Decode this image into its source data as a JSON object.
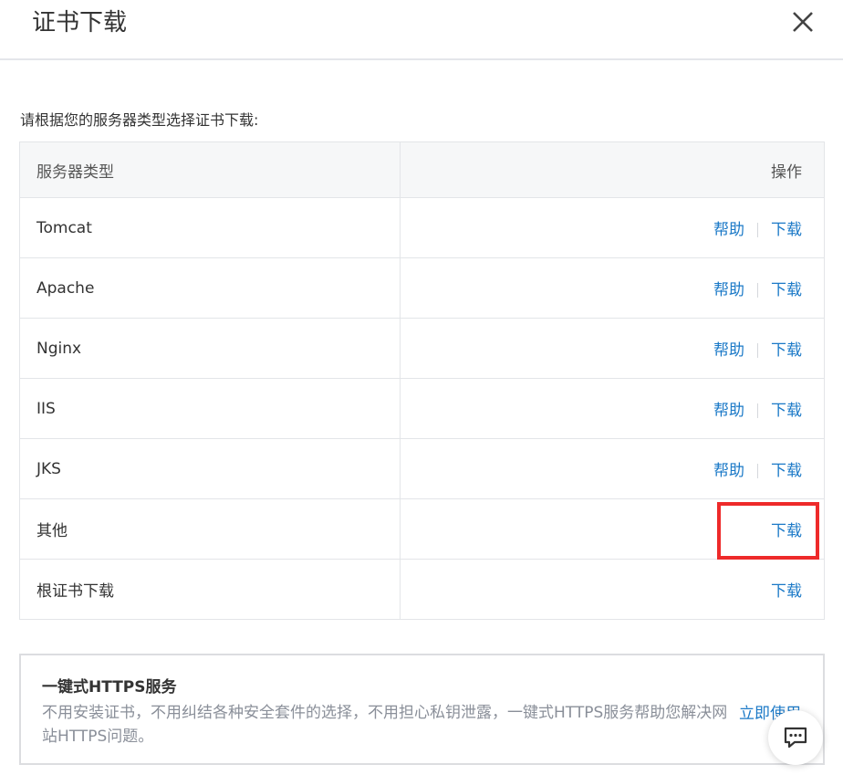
{
  "dialog": {
    "title": "证书下载",
    "close_icon": "close-icon"
  },
  "instruction": "请根据您的服务器类型选择证书下载:",
  "table": {
    "headers": [
      "服务器类型",
      "操作"
    ],
    "rows": [
      {
        "server": "Tomcat",
        "help": "帮助",
        "download": "下载"
      },
      {
        "server": "Apache",
        "help": "帮助",
        "download": "下载"
      },
      {
        "server": "Nginx",
        "help": "帮助",
        "download": "下载"
      },
      {
        "server": "IIS",
        "help": "帮助",
        "download": "下载"
      },
      {
        "server": "JKS",
        "help": "帮助",
        "download": "下载"
      },
      {
        "server": "其他",
        "download": "下载"
      },
      {
        "server": "根证书下载",
        "download": "下载"
      }
    ]
  },
  "promo": {
    "title": "一键式HTTPS服务",
    "description": "不用安装证书，不用纠结各种安全套件的选择，不用担心私钥泄露，一键式HTTPS服务帮助您解决网站HTTPS问题。",
    "cta": "立即使用"
  },
  "chat_icon": "chat-icon",
  "colors": {
    "link": "#1b79c7",
    "highlight": "#ee2a2a",
    "header_bg": "#f6f7f8"
  }
}
